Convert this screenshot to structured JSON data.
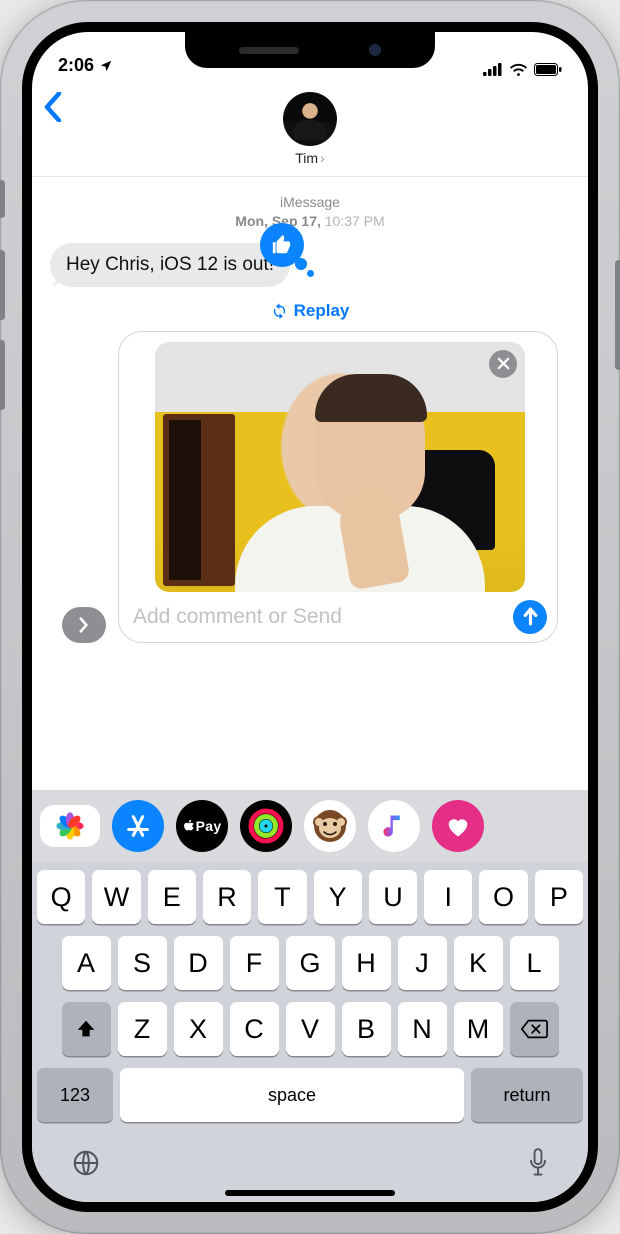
{
  "status": {
    "time": "2:06"
  },
  "header": {
    "contact_name": "Tim"
  },
  "thread": {
    "service": "iMessage",
    "date_bold": "Mon, Sep 17,",
    "date_light": "10:37 PM",
    "incoming_text": "Hey Chris, iOS 12 is out!",
    "replay_label": "Replay"
  },
  "compose": {
    "placeholder": "Add comment or Send"
  },
  "apps": {
    "photos": "Photos",
    "appstore": "App Store",
    "pay": "Pay",
    "activity": "Activity",
    "animoji": "Animoji",
    "music": "Music",
    "digitaltouch": "Digital Touch"
  },
  "keyboard": {
    "row1": [
      "Q",
      "W",
      "E",
      "R",
      "T",
      "Y",
      "U",
      "I",
      "O",
      "P"
    ],
    "row2": [
      "A",
      "S",
      "D",
      "F",
      "G",
      "H",
      "J",
      "K",
      "L"
    ],
    "row3": [
      "Z",
      "X",
      "C",
      "V",
      "B",
      "N",
      "M"
    ],
    "numeric": "123",
    "space": "space",
    "return": "return"
  }
}
